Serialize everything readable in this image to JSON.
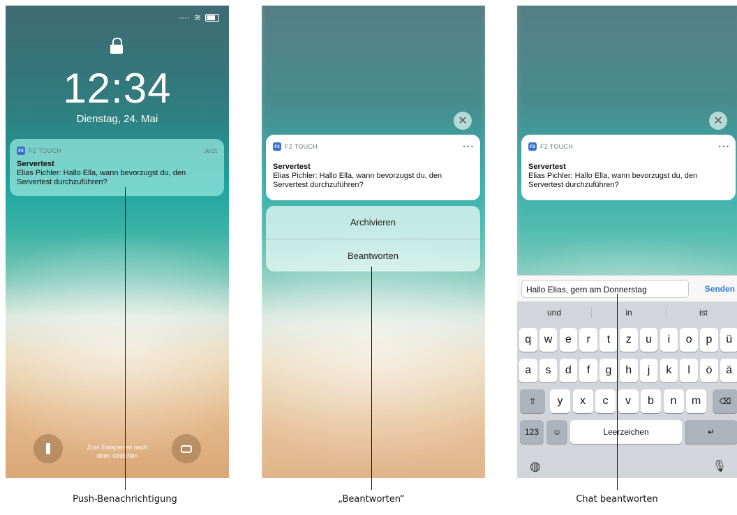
{
  "lock_screen": {
    "time": "12:34",
    "date": "Dienstag, 24. Mai",
    "unlock_hint_line1": "Zum Entsperren nach",
    "unlock_hint_line2": "oben streichen"
  },
  "notification": {
    "app_badge": "F2",
    "app_name": "F2 TOUCH",
    "timestamp": "Jetzt",
    "title": "Servertest",
    "body": "Elias Pichler: Hallo Ella, wann bevorzugst du, den Servertest durchzuführen?",
    "more_label": "• • •"
  },
  "actions": {
    "archive_label": "Archivieren",
    "reply_label": "Beantworten"
  },
  "reply": {
    "input_value": "Hallo Elias, gern am Donnerstag",
    "send_label": "Senden"
  },
  "keyboard": {
    "suggestions": [
      "und",
      "in",
      "ist"
    ],
    "row1": [
      "q",
      "w",
      "e",
      "r",
      "t",
      "z",
      "u",
      "i",
      "o",
      "p",
      "ü"
    ],
    "row2": [
      "a",
      "s",
      "d",
      "f",
      "g",
      "h",
      "j",
      "k",
      "l",
      "ö",
      "ä"
    ],
    "row3": [
      "y",
      "x",
      "c",
      "v",
      "b",
      "n",
      "m"
    ],
    "numbers_label": "123",
    "space_label": "Leerzeichen"
  },
  "captions": {
    "left": "Push-Benachrichtigung",
    "middle": "„Beantworten“",
    "right": "Chat beantworten"
  },
  "icons": {
    "lock": "lock-icon",
    "flashlight": "flashlight-icon",
    "camera": "camera-icon",
    "close": "close-icon",
    "shift": "shift-icon",
    "delete": "delete-icon",
    "emoji": "emoji-icon",
    "return": "return-icon",
    "globe": "globe-icon",
    "mic": "microphone-icon"
  }
}
